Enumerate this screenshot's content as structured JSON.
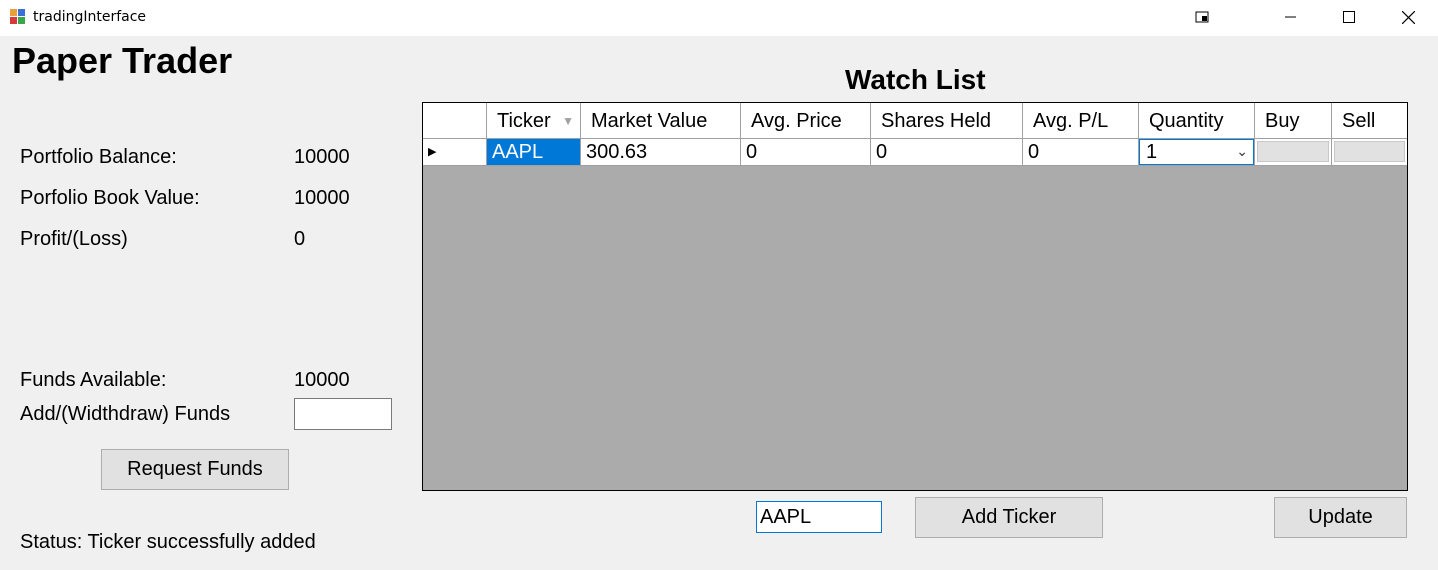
{
  "window": {
    "title": "tradingInterface"
  },
  "app": {
    "heading": "Paper Trader"
  },
  "summary": {
    "portfolio_balance_label": "Portfolio Balance:",
    "portfolio_balance_value": "10000",
    "book_value_label": "Porfolio Book Value:",
    "book_value_value": "10000",
    "profit_loss_label": "Profit/(Loss)",
    "profit_loss_value": "0"
  },
  "funds": {
    "available_label": "Funds Available:",
    "available_value": "10000",
    "add_withdraw_label": "Add/(Widthdraw) Funds",
    "add_withdraw_value": "",
    "request_button": "Request Funds"
  },
  "status": {
    "text": "Status: Ticker successfully added"
  },
  "watchlist": {
    "title": "Watch List",
    "columns": [
      "Ticker",
      "Market Value",
      "Avg. Price",
      "Shares Held",
      "Avg. P/L",
      "Quantity",
      "Buy",
      "Sell"
    ],
    "rows": [
      {
        "ticker": "AAPL",
        "market_value": "300.63",
        "avg_price": "0",
        "shares_held": "0",
        "avg_pl": "0",
        "quantity": "1",
        "buy": "",
        "sell": ""
      }
    ],
    "selection_color": "#0078d7",
    "empty_area_color": "#ababab"
  },
  "controls": {
    "ticker_input_value": "AAPL",
    "add_ticker_button": "Add Ticker",
    "update_button": "Update"
  },
  "icons": {
    "app": "app-window-icon",
    "row_marker": "current-row-arrow-icon",
    "sort": "sort-arrow-icon",
    "dropdown": "chevron-down-icon"
  }
}
